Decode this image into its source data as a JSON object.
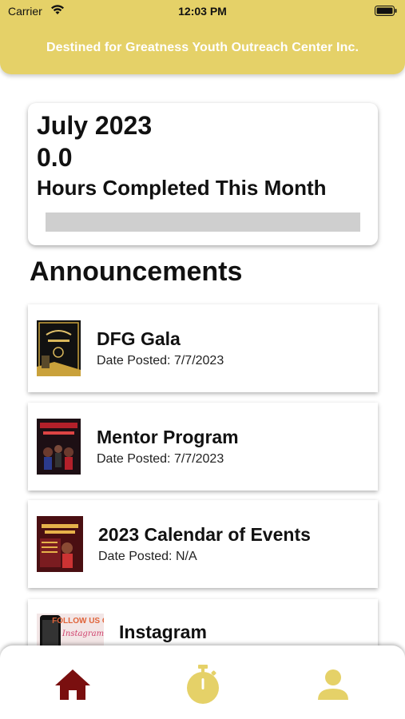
{
  "status_bar": {
    "carrier": "Carrier",
    "time": "12:03 PM"
  },
  "header": {
    "title": "Destined for Greatness Youth Outreach Center Inc."
  },
  "hours_card": {
    "month": "July 2023",
    "hours": "0.0",
    "caption": "Hours Completed This Month",
    "progress_fraction": 0.0
  },
  "announcements_heading": "Announcements",
  "announcements": [
    {
      "title": "DFG Gala",
      "date": "Date Posted: 7/7/2023",
      "thumb_icon": "gala-flyer-thumbnail"
    },
    {
      "title": "Mentor Program",
      "date": "Date Posted: 7/7/2023",
      "thumb_icon": "mentor-flyer-thumbnail"
    },
    {
      "title": "2023 Calendar of Events",
      "date": "Date Posted: N/A",
      "thumb_icon": "calendar-flyer-thumbnail"
    },
    {
      "title": "Instagram",
      "date": "",
      "thumb_icon": "instagram-flyer-thumbnail",
      "thumb_text": "FOLLOW US ON"
    }
  ],
  "tab_bar": {
    "items": [
      {
        "name": "home",
        "icon": "home-icon",
        "active": true
      },
      {
        "name": "timer",
        "icon": "stopwatch-icon",
        "active": false
      },
      {
        "name": "profile",
        "icon": "person-icon",
        "active": false
      }
    ]
  },
  "colors": {
    "accent": "#e5d168",
    "active_tab": "#7a0f0f",
    "inactive_tab": "#e5d168",
    "progress_track": "#cfcfcf"
  }
}
